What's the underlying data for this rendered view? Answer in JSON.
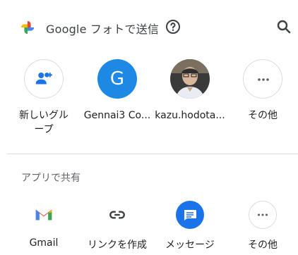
{
  "header": {
    "title": "Google フォトで送信",
    "icons": [
      "google-photos-logo",
      "help-icon",
      "search-icon"
    ]
  },
  "contacts": [
    {
      "label": "新しいグループ",
      "label_lines": [
        "新しいグル",
        "ープ"
      ],
      "icon": "add-group-icon"
    },
    {
      "label": "Gennai3 Co...",
      "avatar_letter": "G"
    },
    {
      "label": "kazu.hodota..."
    },
    {
      "label": "その他",
      "icon": "more-icon"
    }
  ],
  "section": {
    "title": "アプリで共有"
  },
  "apps": [
    {
      "label": "Gmail",
      "icon": "gmail-icon"
    },
    {
      "label": "リンクを作成",
      "icon": "link-icon"
    },
    {
      "label": "メッセージ",
      "icon": "messages-icon"
    },
    {
      "label": "その他",
      "icon": "more-icon"
    }
  ],
  "colors": {
    "accent": "#1a73e8",
    "avatar_g": "#1e88e5",
    "divider": "#dadce0",
    "text_secondary": "#5f6368"
  }
}
